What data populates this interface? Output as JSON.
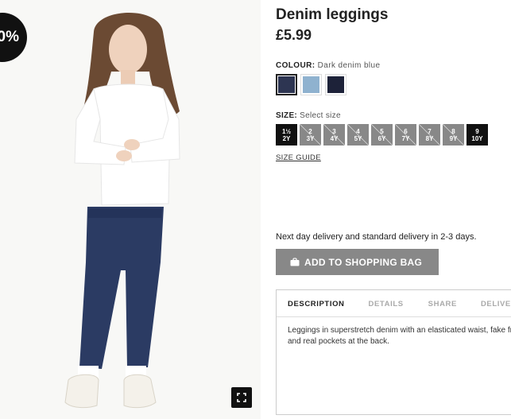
{
  "badge": {
    "text": "0%"
  },
  "product": {
    "title": "Denim leggings",
    "price": "£5.99"
  },
  "colour": {
    "label": "COLOUR:",
    "selected": "Dark denim blue",
    "swatches": [
      {
        "name": "Dark denim blue",
        "color": "#2d3552",
        "selected": true
      },
      {
        "name": "Light denim blue",
        "color": "#8fb2cf",
        "selected": false
      },
      {
        "name": "Dark blue",
        "color": "#1d2239",
        "selected": false
      }
    ]
  },
  "size": {
    "label": "SIZE:",
    "placeholder": "Select size",
    "options": [
      {
        "line1": "1½",
        "line2": "2Y",
        "available": true
      },
      {
        "line1": "2",
        "line2": "3Y",
        "available": false
      },
      {
        "line1": "3",
        "line2": "4Y",
        "available": false
      },
      {
        "line1": "4",
        "line2": "5Y",
        "available": false
      },
      {
        "line1": "5",
        "line2": "6Y",
        "available": false
      },
      {
        "line1": "6",
        "line2": "7Y",
        "available": false
      },
      {
        "line1": "7",
        "line2": "8Y",
        "available": false
      },
      {
        "line1": "8",
        "line2": "9Y",
        "available": false
      },
      {
        "line1": "9",
        "line2": "10Y",
        "available": true
      }
    ],
    "guide_label": "SIZE GUIDE"
  },
  "delivery_text": "Next day delivery and standard delivery in 2-3 days.",
  "add_to_bag": {
    "label": "ADD TO SHOPPING BAG",
    "icon": "shopping-bag-icon"
  },
  "tabs": {
    "description": "DESCRIPTION",
    "details": "DETAILS",
    "share": "SHARE",
    "delivery": "DELIVERY"
  },
  "description": {
    "line1": "Leggings in superstretch denim with an elasticated waist, fake front pockets",
    "line2": "and real pockets at the back."
  },
  "colors": {
    "badge_bg": "#111111",
    "button_bg": "#888888",
    "size_available": "#111111",
    "size_unavailable": "#888888"
  },
  "zoom_icon": "fullscreen-icon"
}
